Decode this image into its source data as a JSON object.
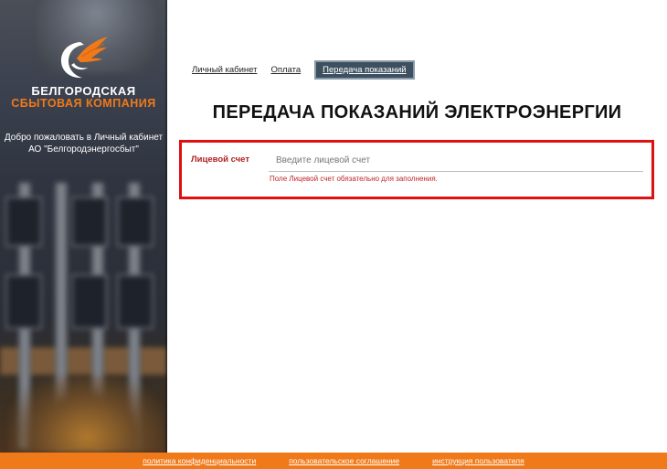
{
  "sidebar": {
    "brand_line1": "БЕЛГОРОДСКАЯ",
    "brand_line2": "СБЫТОВАЯ КОМПАНИЯ",
    "welcome_line1": "Добро пожаловать в Личный кабинет",
    "welcome_line2": "АО \"Белгородэнергосбыт\"",
    "logo_icon": "company-logo-icon",
    "brand_colors": {
      "orange": "#f07a1a",
      "white": "#ffffff"
    }
  },
  "nav": {
    "items": [
      {
        "label": "Личный кабинет",
        "active": false
      },
      {
        "label": "Оплата",
        "active": false
      },
      {
        "label": "Передача показаний",
        "active": true
      }
    ]
  },
  "main": {
    "title": "ПЕРЕДАЧА ПОКАЗАНИЙ ЭЛЕКТРОЭНЕРГИИ",
    "form": {
      "account_label": "Лицевой счет",
      "account_placeholder": "Введите лицевой счет",
      "account_value": "",
      "account_error": "Поле Лицевой счет обязательно для заполнения.",
      "highlight_color": "#e01010",
      "error_color": "#c02525"
    }
  },
  "footer": {
    "links": [
      "политика конфиденциальности",
      "пользовательское соглашение",
      "инструкция пользователя"
    ],
    "background": "#f07a1a"
  }
}
